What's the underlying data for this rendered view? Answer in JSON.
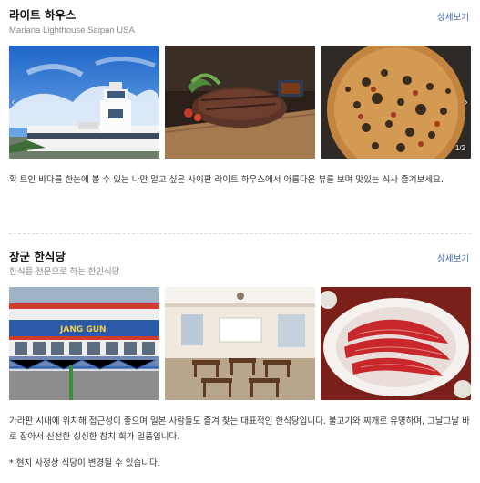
{
  "sections": [
    {
      "title": "라이트 하우스",
      "subtitle": "Mariana Lighthouse Saipan USA",
      "detail_label": "상세보기",
      "counter": "1/2",
      "description": "확 트인 바다를 한눈에 볼 수 있는 나만 알고 싶은 사이판 라이트 하우스에서 아름다운 뷰를 보며 맛있는 식사 즐겨보세요."
    },
    {
      "title": "장군 한식당",
      "subtitle": "한식을 전문으로 하는 한인식당",
      "detail_label": "상세보기",
      "sign_text": "JANG GUN",
      "description": "가라판 시내에 위치해 접근성이 좋으며 일본 사람들도 즐겨 찾는 대표적인 한식당입니다. 불고기와 찌개로 유명하며, 그날그날 바로 잡아서 신선한 싱싱한 참치 회가 일품입니다."
    }
  ],
  "note": "* 현지 사정상 식당이 변경될 수 있습니다.",
  "icons": {
    "prev": "chevron-left-icon",
    "next": "chevron-right-icon"
  }
}
